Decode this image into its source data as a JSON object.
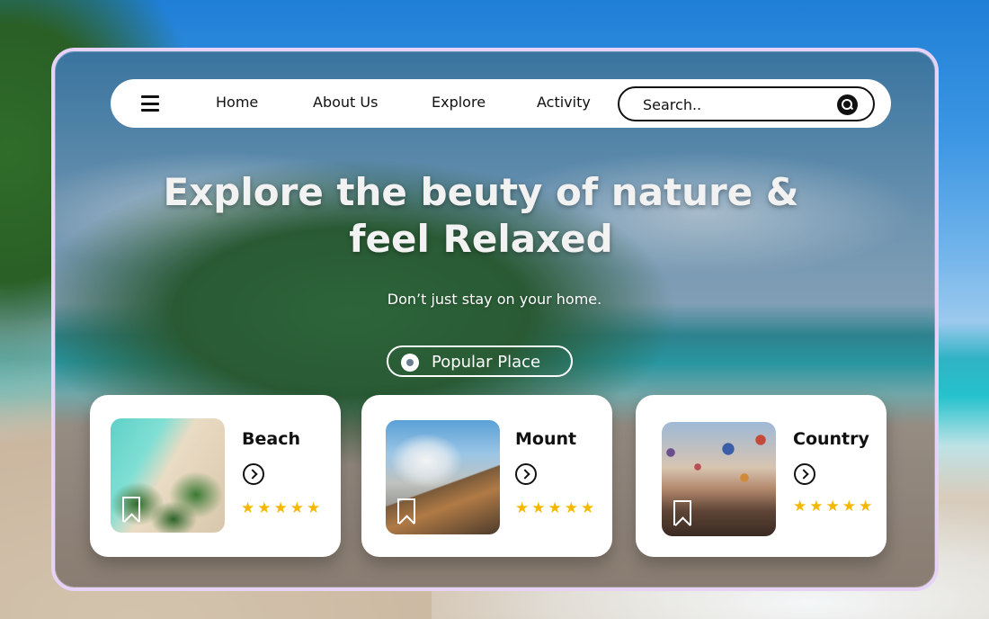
{
  "nav": {
    "links": [
      "Home",
      "About Us",
      "Explore",
      "Activity"
    ],
    "search_placeholder": "Search.."
  },
  "hero": {
    "title_line1": "Explore the beuty of nature &",
    "title_line2": "feel Relaxed",
    "subtitle": "Don’t just stay on your home.",
    "popular_label": "Popular Place"
  },
  "cards": [
    {
      "title": "Beach",
      "rating": 5,
      "stars": "★★★★★",
      "image": "beach-photo"
    },
    {
      "title": "Mount",
      "rating": 5,
      "stars": "★★★★★",
      "image": "volcano-photo"
    },
    {
      "title": "Country",
      "rating": 5,
      "stars": "★★★★★",
      "image": "hot-air-balloons-photo"
    }
  ],
  "colors": {
    "frame_border": "#e6d3f7",
    "star": "#f5b800",
    "nav_background": "#ffffff"
  },
  "icons": [
    "menu-icon",
    "search-icon",
    "location-pin-icon",
    "bookmark-icon",
    "arrow-right-circle-icon",
    "star-icon"
  ]
}
